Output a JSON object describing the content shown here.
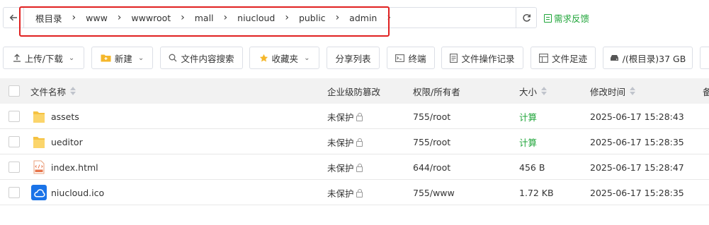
{
  "path": {
    "crumbs": [
      "根目录",
      "www",
      "wwwroot",
      "mall",
      "niucloud",
      "public",
      "admin"
    ],
    "feedback": "需求反馈"
  },
  "toolbar": {
    "upload": "上传/下载",
    "new": "新建",
    "search": "文件内容搜索",
    "favorites": "收藏夹",
    "share_list": "分享列表",
    "terminal": "终端",
    "op_log": "文件操作记录",
    "footprint": "文件足迹",
    "disk": "/(根目录)37 GB"
  },
  "table": {
    "headers": {
      "name": "文件名称",
      "protect": "企业级防篡改",
      "perm": "权限/所有者",
      "size": "大小",
      "mtime": "修改时间",
      "more": "备"
    },
    "rows": [
      {
        "icon": "folder-icon",
        "name": "assets",
        "protect": "未保护",
        "perm": "755/root",
        "size": "计算",
        "size_is_link": true,
        "mtime": "2025-06-17 15:28:43"
      },
      {
        "icon": "folder-icon",
        "name": "ueditor",
        "protect": "未保护",
        "perm": "755/root",
        "size": "计算",
        "size_is_link": true,
        "mtime": "2025-06-17 15:28:35"
      },
      {
        "icon": "html-file-icon",
        "name": "index.html",
        "protect": "未保护",
        "perm": "644/root",
        "size": "456 B",
        "size_is_link": false,
        "mtime": "2025-06-17 15:28:47"
      },
      {
        "icon": "niucloud-ico-icon",
        "name": "niucloud.ico",
        "protect": "未保护",
        "perm": "755/www",
        "size": "1.72 KB",
        "size_is_link": false,
        "mtime": "2025-06-17 15:28:35"
      }
    ]
  },
  "colors": {
    "accent": "#20a53a",
    "highlight": "#e02020"
  }
}
